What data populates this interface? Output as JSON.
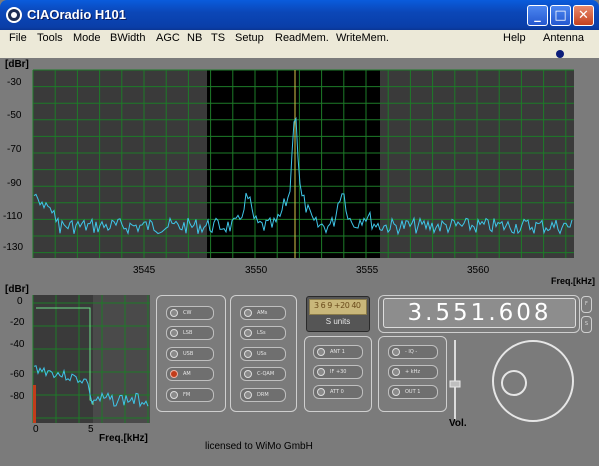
{
  "window": {
    "title": "CIAOradio H101"
  },
  "menu": {
    "items": [
      "File",
      "Tools",
      "Mode",
      "BWidth",
      "AGC",
      "NB",
      "TS",
      "Setup",
      "ReadMem.",
      "WriteMem."
    ],
    "right_items": [
      "Help",
      "Antenna"
    ]
  },
  "spectrum": {
    "unit_label": "[dBr]",
    "x_label": "Freq.[kHz]",
    "y_ticks": [
      "-30",
      "-50",
      "-70",
      "-90",
      "-110",
      "-130"
    ],
    "x_ticks": [
      "3545",
      "3550",
      "3555",
      "3560"
    ]
  },
  "audio_scope": {
    "unit_label": "[dBr]",
    "x_label": "Freq.[kHz]",
    "y_ticks": [
      "0",
      "-20",
      "-40",
      "-60",
      "-80"
    ],
    "x_ticks": [
      "0",
      "5"
    ]
  },
  "mode_buttons": [
    {
      "label": "CW",
      "active": false
    },
    {
      "label": "LSB",
      "active": false
    },
    {
      "label": "USB",
      "active": false
    },
    {
      "label": "AM",
      "active": true
    },
    {
      "label": "FM",
      "active": false
    }
  ],
  "sub_mode_buttons": [
    {
      "label": "AMs",
      "active": false
    },
    {
      "label": "LSs",
      "active": false
    },
    {
      "label": "USs",
      "active": false
    },
    {
      "label": "C-QAM",
      "active": false
    },
    {
      "label": "DRM",
      "active": false
    }
  ],
  "smeter": {
    "scale": "3 6 9 +20 40",
    "label": "S units"
  },
  "rx_buttons": [
    {
      "label": "ANT 1",
      "active": false
    },
    {
      "label": "IF +30",
      "active": false
    },
    {
      "label": "ATT 0",
      "active": false
    }
  ],
  "if_buttons": [
    {
      "label": "- IQ -",
      "active": false
    },
    {
      "label": "+ kHz",
      "active": false
    },
    {
      "label": "OUT 1",
      "active": false
    }
  ],
  "frequency": {
    "display": "3.551.608",
    "side_buttons": [
      "F",
      "S"
    ]
  },
  "volume": {
    "label": "Vol.",
    "level": 0.45
  },
  "footer": {
    "license": "licensed to  WiMo GmbH"
  },
  "colors": {
    "trace": "#3fc6e8",
    "scope_line": "#6ee08a",
    "grid": "#1d7b28",
    "filter_passband": "#000000",
    "plot_background": "#3a3a3a",
    "active_led": "#c23c1a"
  }
}
